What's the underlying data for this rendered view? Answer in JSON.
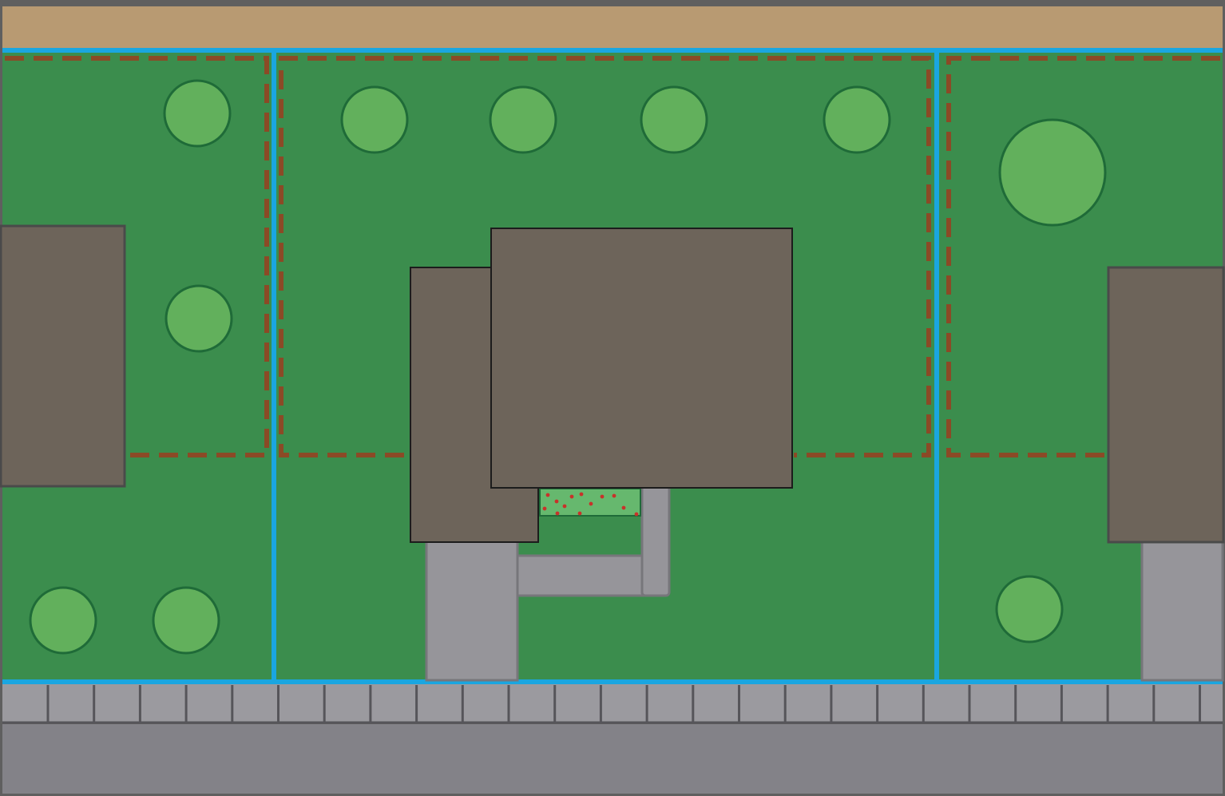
{
  "colors": {
    "frame": "#5f5f5f",
    "alley": "#b89a72",
    "lawn": "#3b8d4d",
    "tree_fill": "#62b05c",
    "tree_stroke": "#1f6b38",
    "roof": "#6d645a",
    "roof_stroke_dark": "#1c1c1c",
    "roof_stroke_soft": "#4a4a4a",
    "concrete": "#96959a",
    "concrete_stroke": "#77767b",
    "property_line": "#1aa6e0",
    "fence": "#8b4a26",
    "planter_fill": "#66b86e",
    "planter_dots": "#c8322a",
    "sidewalk": "#9b9a9f",
    "sidewalk_joint": "#56555a",
    "street": "#838288"
  },
  "map": {
    "lots": [
      {
        "name": "lot-left"
      },
      {
        "name": "lot-center"
      },
      {
        "name": "lot-right"
      }
    ],
    "features": [
      "alley",
      "fence",
      "property-line",
      "tree",
      "house-roof",
      "driveway",
      "walkway",
      "planter",
      "sidewalk",
      "street"
    ]
  }
}
